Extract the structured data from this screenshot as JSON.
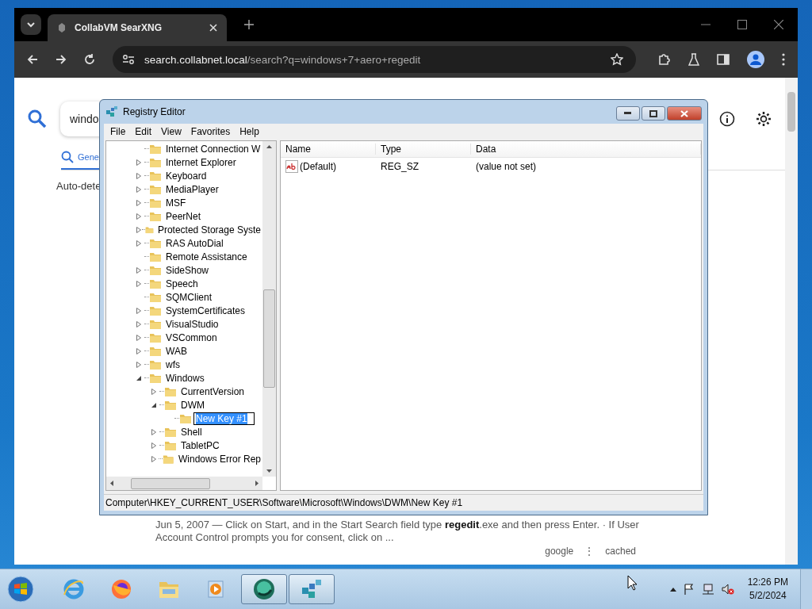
{
  "browser": {
    "tab_title": "CollabVM SearXNG",
    "url_host": "search.collabnet.local",
    "url_path": "/search?q=windows+7+aero+regedit"
  },
  "page": {
    "search_value": "windo",
    "tab_label": "Gene",
    "autodetect": "Auto-dete",
    "result_snippet": "Jun 5, 2007 — Click on Start, and in the Start Search field type **regedit**.exe and then press Enter. · If User Account Control prompts you for consent, click on ...",
    "engine": "google",
    "separator": "⋮",
    "cached": "cached"
  },
  "regedit": {
    "title": "Registry Editor",
    "menu": [
      "File",
      "Edit",
      "View",
      "Favorites",
      "Help"
    ],
    "tree": [
      {
        "label": "Internet Connection W",
        "expandable": false,
        "editing": false
      },
      {
        "label": "Internet Explorer",
        "expandable": true,
        "expanded": false,
        "editing": false
      },
      {
        "label": "Keyboard",
        "expandable": true,
        "expanded": false,
        "editing": false
      },
      {
        "label": "MediaPlayer",
        "expandable": true,
        "expanded": false,
        "editing": false
      },
      {
        "label": "MSF",
        "expandable": true,
        "expanded": false,
        "editing": false
      },
      {
        "label": "PeerNet",
        "expandable": true,
        "expanded": false,
        "editing": false
      },
      {
        "label": "Protected Storage Syste",
        "expandable": true,
        "expanded": false,
        "editing": false
      },
      {
        "label": "RAS AutoDial",
        "expandable": true,
        "expanded": false,
        "editing": false
      },
      {
        "label": "Remote Assistance",
        "expandable": false,
        "editing": false
      },
      {
        "label": "SideShow",
        "expandable": true,
        "expanded": false,
        "editing": false
      },
      {
        "label": "Speech",
        "expandable": true,
        "expanded": false,
        "editing": false
      },
      {
        "label": "SQMClient",
        "expandable": false,
        "editing": false
      },
      {
        "label": "SystemCertificates",
        "expandable": true,
        "expanded": false,
        "editing": false
      },
      {
        "label": "VisualStudio",
        "expandable": true,
        "expanded": false,
        "editing": false
      },
      {
        "label": "VSCommon",
        "expandable": true,
        "expanded": false,
        "editing": false
      },
      {
        "label": "WAB",
        "expandable": true,
        "expanded": false,
        "editing": false
      },
      {
        "label": "wfs",
        "expandable": true,
        "expanded": false,
        "editing": false
      },
      {
        "label": "Windows",
        "expandable": true,
        "expanded": true,
        "editing": false,
        "children": [
          {
            "label": "CurrentVersion",
            "expandable": true,
            "expanded": false,
            "editing": false
          },
          {
            "label": "DWM",
            "expandable": true,
            "expanded": true,
            "editing": false,
            "children": [
              {
                "label": "New Key #1",
                "expandable": false,
                "editing": true
              }
            ]
          },
          {
            "label": "Shell",
            "expandable": true,
            "expanded": false,
            "editing": false
          },
          {
            "label": "TabletPC",
            "expandable": true,
            "expanded": false,
            "editing": false
          },
          {
            "label": "Windows Error Rep",
            "expandable": true,
            "expanded": false,
            "editing": false
          }
        ]
      }
    ],
    "columns": [
      "Name",
      "Type",
      "Data"
    ],
    "values": [
      {
        "name": "(Default)",
        "type": "REG_SZ",
        "data": "(value not set)"
      }
    ],
    "status_path": "Computer\\HKEY_CURRENT_USER\\Software\\Microsoft\\Windows\\DWM\\New Key #1"
  },
  "taskbar": {
    "apps": [
      {
        "kind": "ie",
        "active": false
      },
      {
        "kind": "firefox",
        "active": false
      },
      {
        "kind": "explorer",
        "active": false
      },
      {
        "kind": "media",
        "active": false
      },
      {
        "kind": "collab",
        "active": true
      },
      {
        "kind": "regedit",
        "active": true
      }
    ],
    "time": "12:26 PM",
    "date": "5/2/2024"
  }
}
